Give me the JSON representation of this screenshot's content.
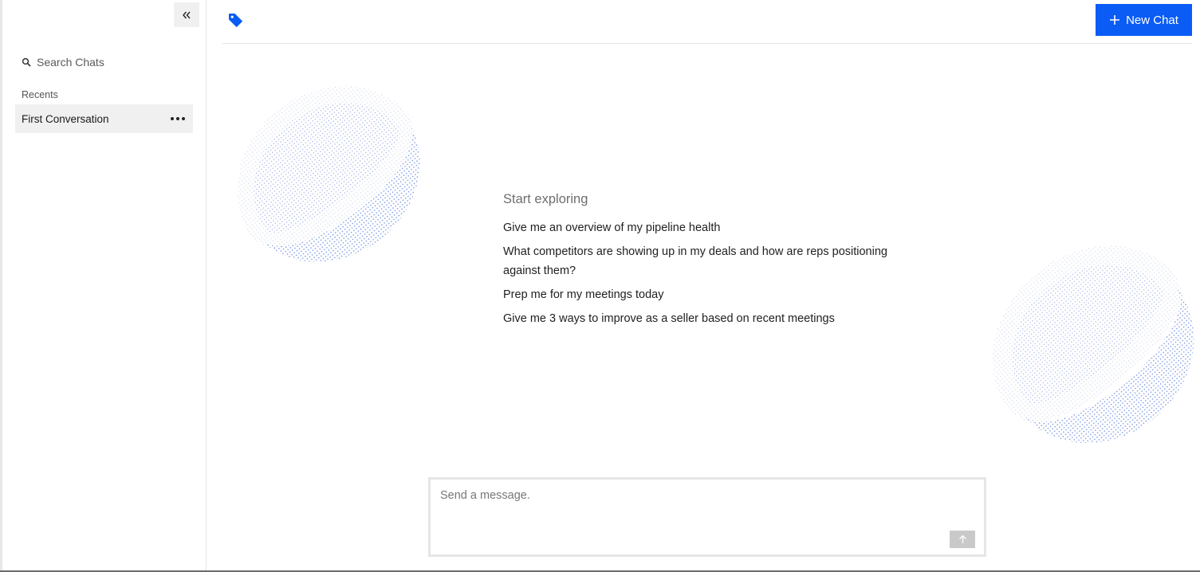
{
  "sidebar": {
    "search_label": "Search Chats",
    "recents_label": "Recents",
    "chats": [
      {
        "label": "First Conversation"
      }
    ]
  },
  "header": {
    "new_chat_label": "New Chat"
  },
  "explore": {
    "title": "Start exploring",
    "suggestions": [
      "Give me an overview of my pipeline health",
      "What competitors are showing up in my deals and how are reps positioning against them?",
      "Prep me for my meetings today",
      "Give me 3 ways to improve as a seller based on recent meetings"
    ]
  },
  "composer": {
    "placeholder": "Send a message.",
    "value": ""
  },
  "colors": {
    "accent": "#0a5cf5",
    "dot": "#4a6fd6"
  },
  "icons": {
    "collapse": "double-chevron-left-icon",
    "search": "search-icon",
    "more": "more-horizontal-icon",
    "tag": "tag-icon",
    "new_chat": "plus-icon",
    "send": "arrow-up-icon"
  }
}
